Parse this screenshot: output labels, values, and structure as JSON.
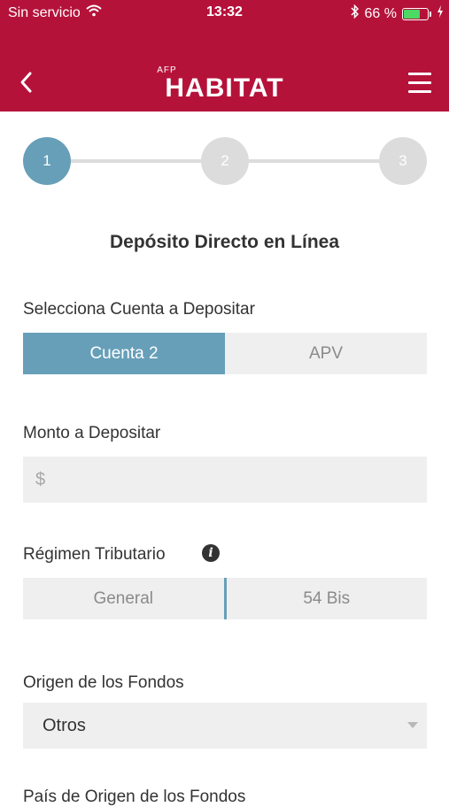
{
  "status_bar": {
    "carrier": "Sin servicio",
    "time": "13:32",
    "battery_text": "66 %",
    "battery_level": 0.66
  },
  "nav": {
    "logo_small": "AFP",
    "logo_main": "HABITAT",
    "brand_color": "#b5123a"
  },
  "stepper": {
    "steps": [
      "1",
      "2",
      "3"
    ],
    "active_step": 1,
    "active_color": "#679fb8"
  },
  "form": {
    "title": "Depósito Directo en Línea",
    "account_label": "Selecciona Cuenta a Depositar",
    "account_options": [
      "Cuenta 2",
      "APV"
    ],
    "account_selected": "Cuenta 2",
    "amount_label": "Monto a Depositar",
    "amount_placeholder": "$",
    "regime_label": "Régimen Tributario",
    "regime_options": [
      "General",
      "54 Bis"
    ],
    "origin_label": "Origen de los Fondos",
    "origin_value": "Otros",
    "next_label_partial": "País de Origen de los Fondos"
  }
}
